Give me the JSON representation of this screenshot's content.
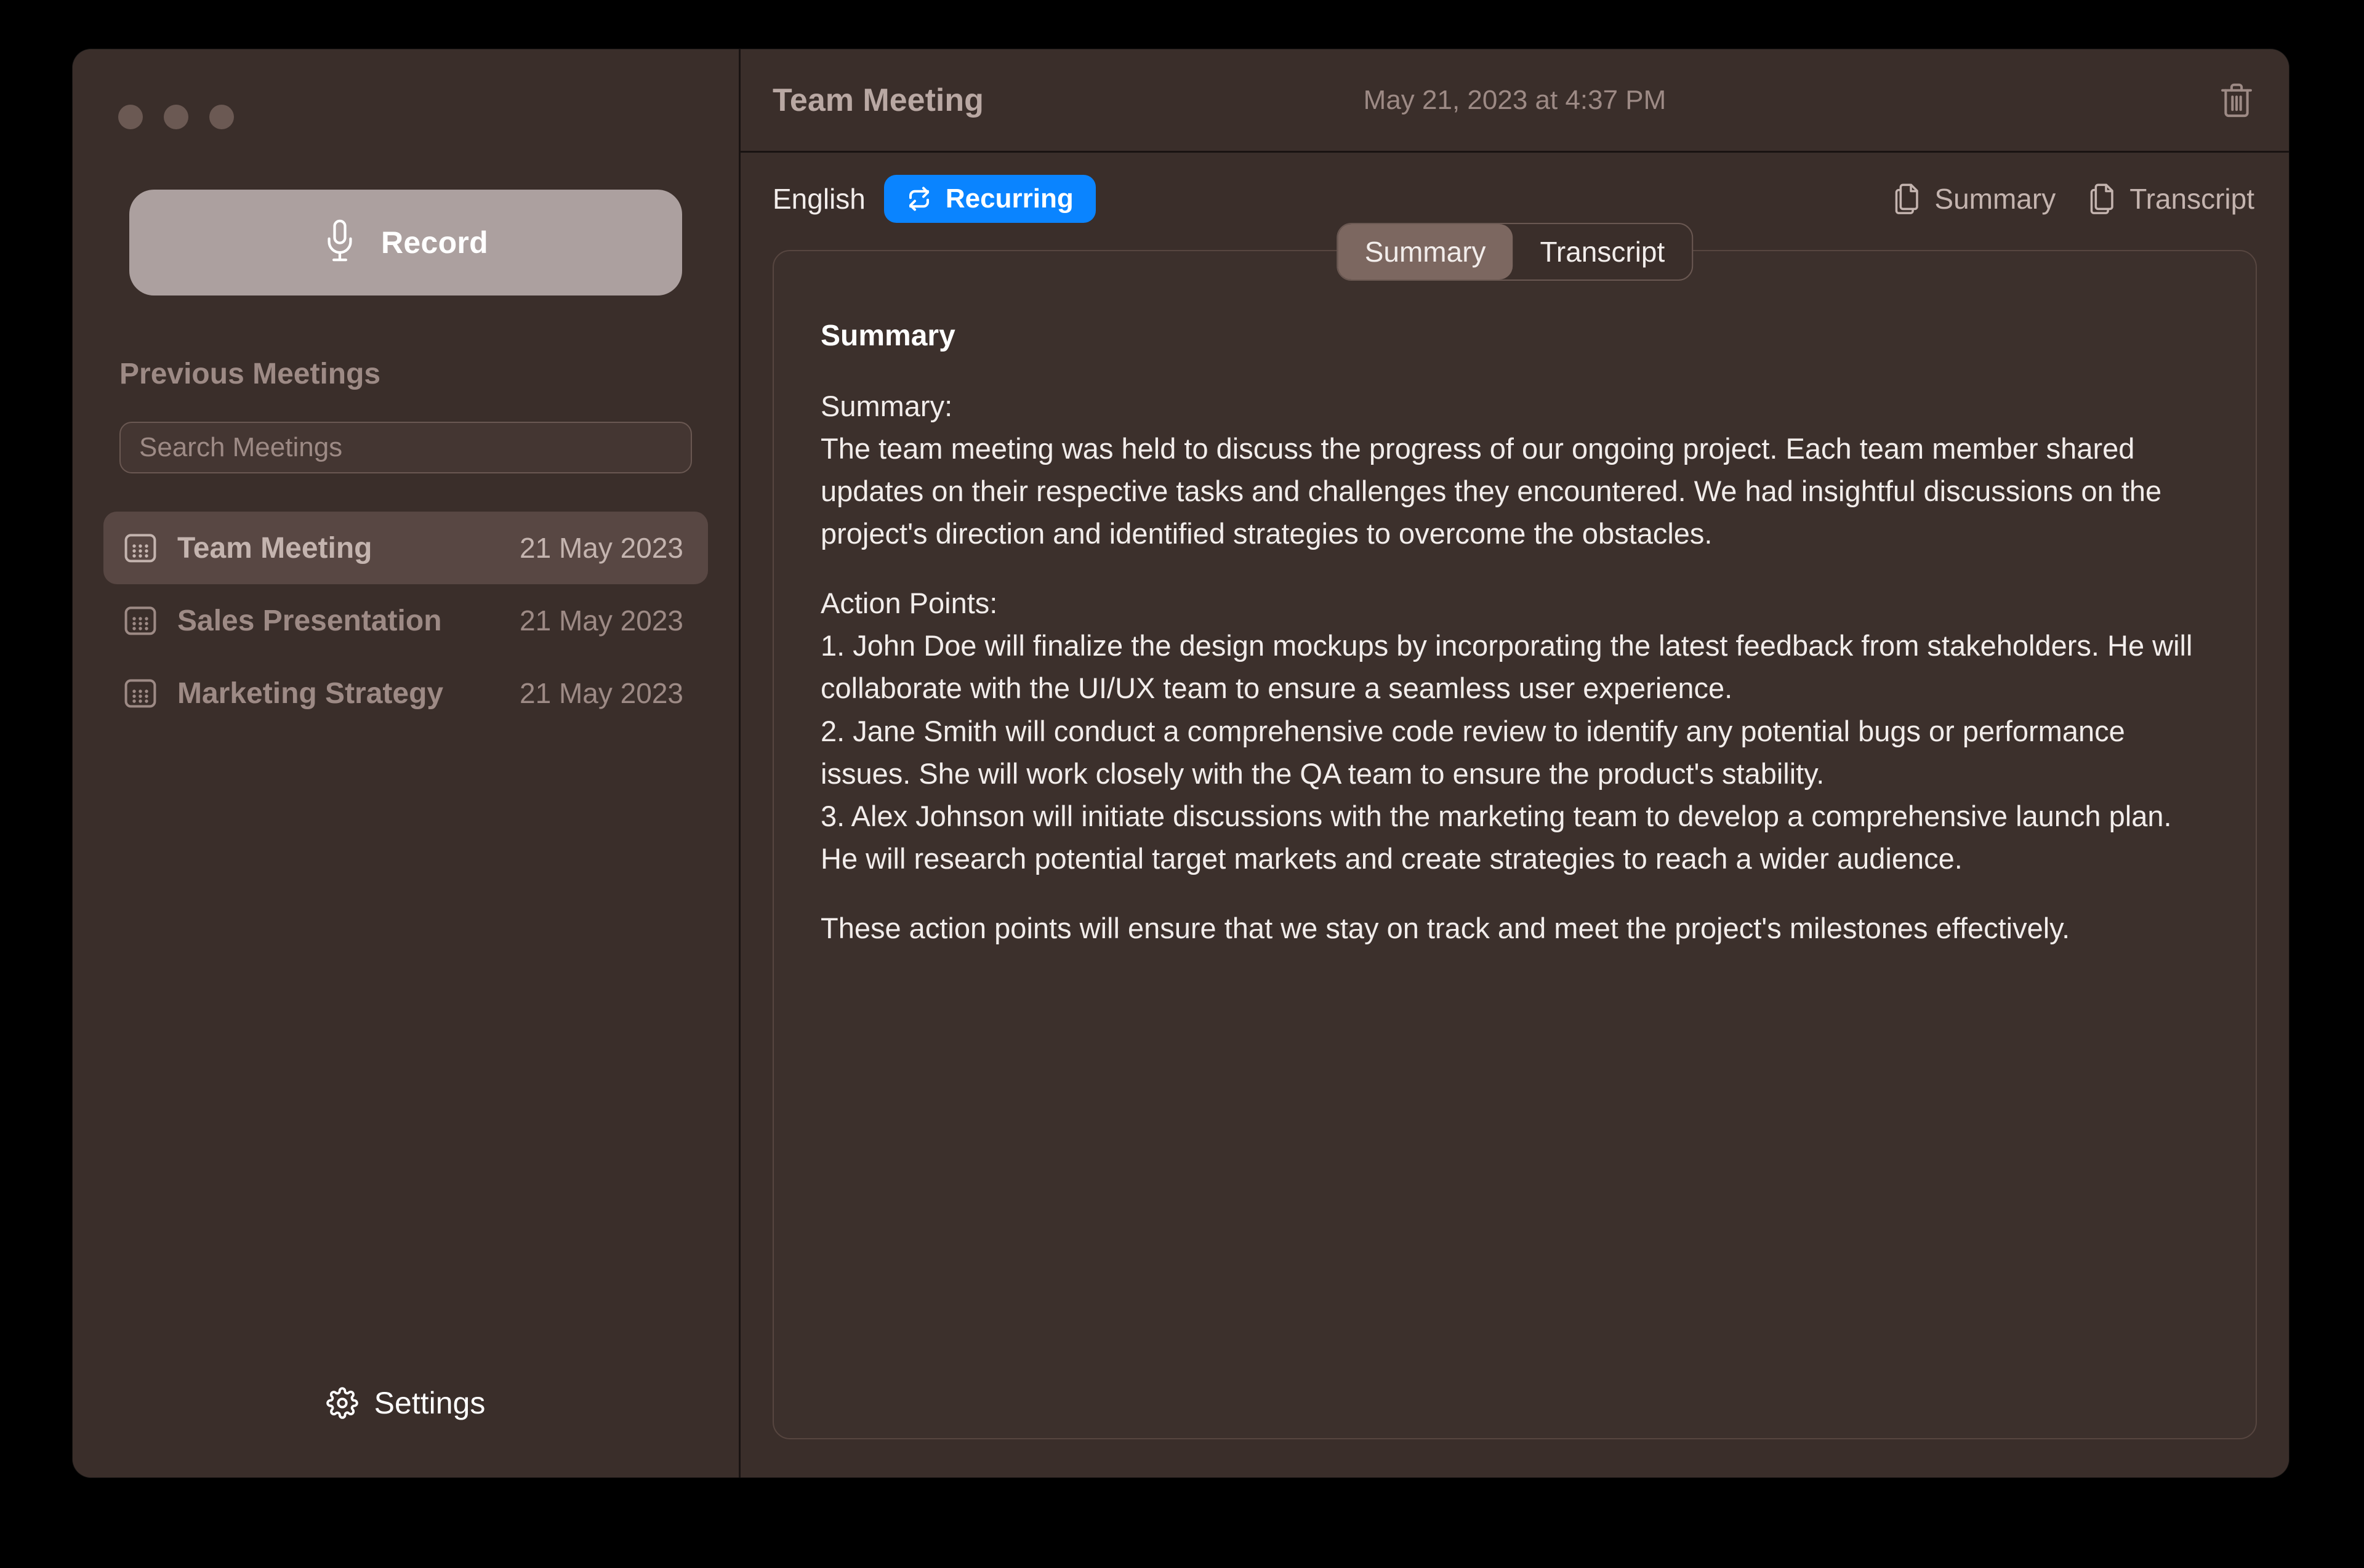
{
  "window": {
    "traffic_lights": [
      "close",
      "minimize",
      "maximize"
    ]
  },
  "sidebar": {
    "record_button": {
      "label": "Record",
      "icon": "microphone-icon"
    },
    "section_title": "Previous Meetings",
    "search": {
      "placeholder": "Search Meetings",
      "value": ""
    },
    "meetings": [
      {
        "name": "Team Meeting",
        "date": "21 May 2023",
        "icon": "calendar-icon",
        "selected": true
      },
      {
        "name": "Sales Presentation",
        "date": "21 May 2023",
        "icon": "calendar-icon",
        "selected": false
      },
      {
        "name": "Marketing Strategy",
        "date": "21 May 2023",
        "icon": "calendar-icon",
        "selected": false
      }
    ],
    "settings": {
      "label": "Settings",
      "icon": "gear-icon"
    }
  },
  "header": {
    "title": "Team Meeting",
    "datetime": "May 21, 2023 at 4:37 PM",
    "delete_icon": "trash-icon"
  },
  "toolbar": {
    "language": "English",
    "recurring": {
      "label": "Recurring",
      "icon": "repeat-icon"
    },
    "actions": [
      {
        "label": "Summary",
        "icon": "copy-document-icon"
      },
      {
        "label": "Transcript",
        "icon": "copy-document-icon"
      }
    ]
  },
  "tabs": {
    "items": [
      {
        "label": "Summary",
        "active": true
      },
      {
        "label": "Transcript",
        "active": false
      }
    ]
  },
  "content": {
    "heading": "Summary",
    "paragraphs": [
      "Summary:\nThe team meeting was held to discuss the progress of our ongoing project. Each team member shared updates on their respective tasks and challenges they encountered. We had insightful discussions on the project's direction and identified strategies to overcome the obstacles.",
      "Action Points:\n1. John Doe will finalize the design mockups by incorporating the latest feedback from stakeholders. He will collaborate with the UI/UX team to ensure a seamless user experience.\n2. Jane Smith will conduct a comprehensive code review to identify any potential bugs or performance issues. She will work closely with the QA team to ensure the product's stability.\n3. Alex Johnson will initiate discussions with the marketing team to develop a comprehensive launch plan. He will research potential target markets and create strategies to reach a wider audience.",
      "These action points will ensure that we stay on track and meet the project's milestones effectively."
    ]
  },
  "colors": {
    "window_bg": "#3A2E2A",
    "accent_blue": "#0A84FF",
    "record_btn": "#ACA09F",
    "muted_text": "#9D8A85",
    "body_text": "#F2EDEB"
  }
}
